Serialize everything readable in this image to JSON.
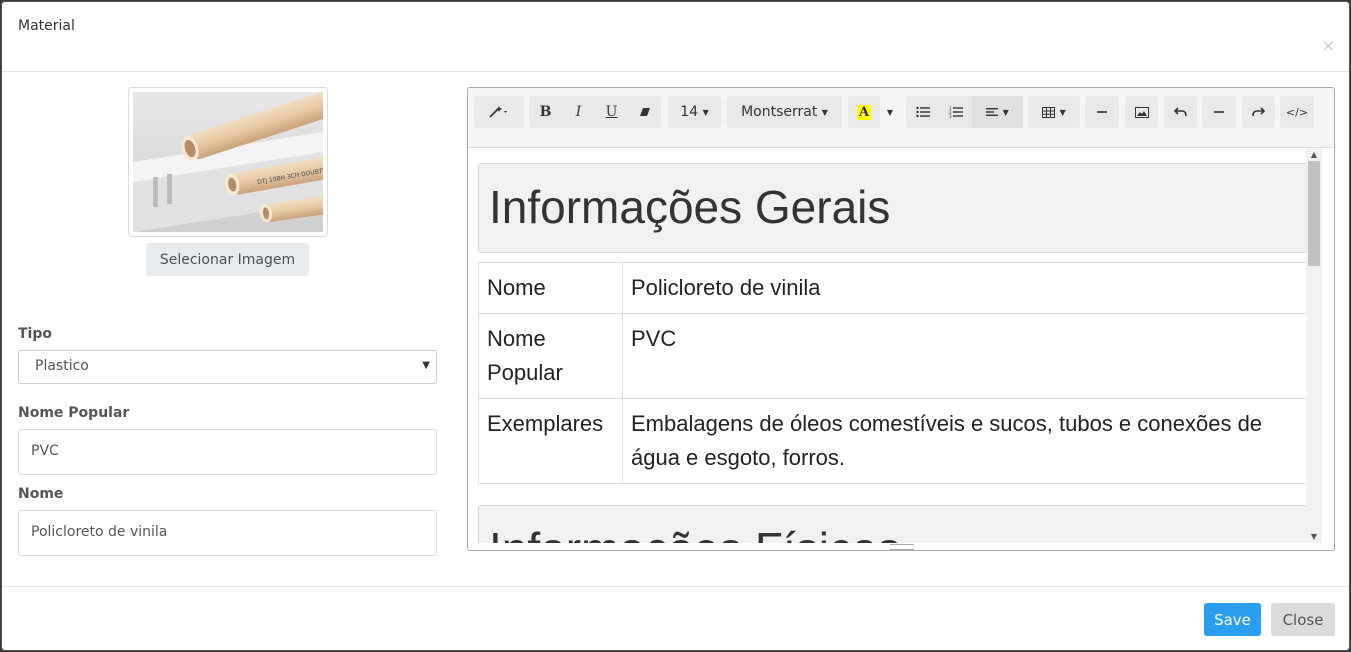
{
  "modal": {
    "title": "Material",
    "close_glyph": "×"
  },
  "image": {
    "alt": "PVC pipes and profile",
    "select_label": "Selecionar Imagem",
    "pipe_text": "DTJ 10BH 3CH DOUBTE"
  },
  "form": {
    "tipo_label": "Tipo",
    "tipo_value": "Plastico",
    "popular_label": "Nome Popular",
    "popular_value": "PVC",
    "nome_label": "Nome",
    "nome_value": "Policloreto de vinila"
  },
  "toolbar": {
    "style_icon": "magic-wand-icon",
    "bold": "B",
    "italic": "I",
    "underline": "U",
    "eraser_icon": "eraser-icon",
    "font_size": "14",
    "font_name": "Montserrat",
    "color_letter": "A",
    "color_swatch": "#ffff00",
    "ul_icon": "unordered-list-icon",
    "ol_icon": "ordered-list-icon",
    "align_icon": "align-left-icon",
    "table_icon": "table-icon",
    "hr_icon": "horizontal-rule-icon",
    "picture_icon": "picture-icon",
    "undo_icon": "undo-icon",
    "redo_icon": "redo-icon",
    "code_label": "</>"
  },
  "editor": {
    "heading1": "Informações Gerais",
    "rows": [
      {
        "key": "Nome",
        "value": "Policloreto de vinila"
      },
      {
        "key": "Nome Popular",
        "value": "PVC"
      },
      {
        "key": "Exemplares",
        "value": "Embalagens de óleos comestíveis e sucos, tubos e conexões de água e esgoto, forros."
      }
    ],
    "heading2": "Informações Físicas"
  },
  "footer": {
    "save_label": "Save",
    "close_label": "Close"
  },
  "colors": {
    "primary": "#2b9fef",
    "secondary": "#dcdcdc"
  }
}
